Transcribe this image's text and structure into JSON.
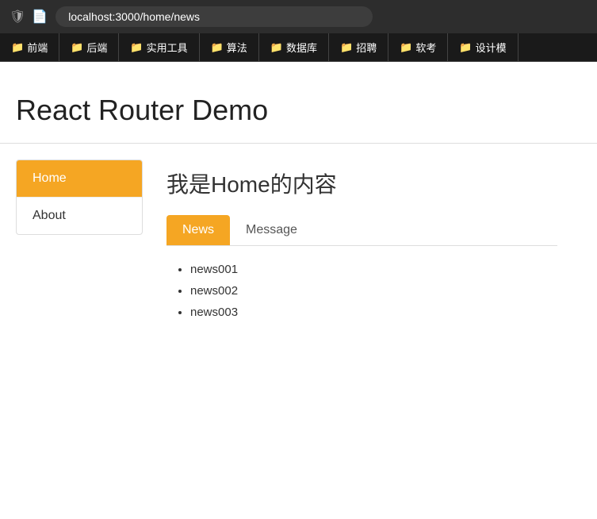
{
  "browser": {
    "address": "localhost:3000/home/news"
  },
  "bookmarks": {
    "items": [
      {
        "label": "前端",
        "icon": "📁"
      },
      {
        "label": "后端",
        "icon": "📁"
      },
      {
        "label": "实用工具",
        "icon": "📁"
      },
      {
        "label": "算法",
        "icon": "📁"
      },
      {
        "label": "数据库",
        "icon": "📁"
      },
      {
        "label": "招聘",
        "icon": "📁"
      },
      {
        "label": "软考",
        "icon": "📁"
      },
      {
        "label": "设计模",
        "icon": "📁"
      }
    ]
  },
  "page": {
    "title": "React Router Demo",
    "home_content": "我是Home的内容"
  },
  "sidebar": {
    "items": [
      {
        "label": "Home",
        "active": true
      },
      {
        "label": "About",
        "active": false
      }
    ]
  },
  "sub_tabs": {
    "items": [
      {
        "label": "News",
        "active": true
      },
      {
        "label": "Message",
        "active": false
      }
    ]
  },
  "news_list": {
    "items": [
      {
        "text": "news001"
      },
      {
        "text": "news002"
      },
      {
        "text": "news003"
      }
    ]
  }
}
